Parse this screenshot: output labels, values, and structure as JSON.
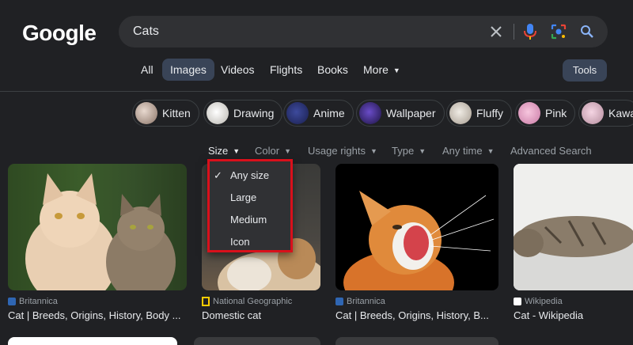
{
  "logo": "Google",
  "search": {
    "query": "Cats"
  },
  "tabs": [
    {
      "label": "All"
    },
    {
      "label": "Images"
    },
    {
      "label": "Videos"
    },
    {
      "label": "Flights"
    },
    {
      "label": "Books"
    },
    {
      "label": "More"
    }
  ],
  "tools_label": "Tools",
  "chips": [
    {
      "label": "Kitten"
    },
    {
      "label": "Drawing"
    },
    {
      "label": "Anime"
    },
    {
      "label": "Wallpaper"
    },
    {
      "label": "Fluffy"
    },
    {
      "label": "Pink"
    },
    {
      "label": "Kawai"
    }
  ],
  "filters": [
    {
      "label": "Size"
    },
    {
      "label": "Color"
    },
    {
      "label": "Usage rights"
    },
    {
      "label": "Type"
    },
    {
      "label": "Any time"
    },
    {
      "label": "Advanced Search"
    }
  ],
  "size_menu": [
    {
      "label": "Any size",
      "checked": true
    },
    {
      "label": "Large"
    },
    {
      "label": "Medium"
    },
    {
      "label": "Icon"
    }
  ],
  "results": [
    {
      "source": "Britannica",
      "title": "Cat | Breeds, Origins, History, Body ..."
    },
    {
      "source": "National Geographic",
      "title": "Domestic cat"
    },
    {
      "source": "Britannica",
      "title": "Cat | Breeds, Origins, History, B..."
    },
    {
      "source": "Wikipedia",
      "title": "Cat - Wikipedia"
    }
  ],
  "colors": {
    "background": "#202124",
    "search_bg": "#303134",
    "active_tab": "#394457",
    "highlight": "#d9101b"
  }
}
